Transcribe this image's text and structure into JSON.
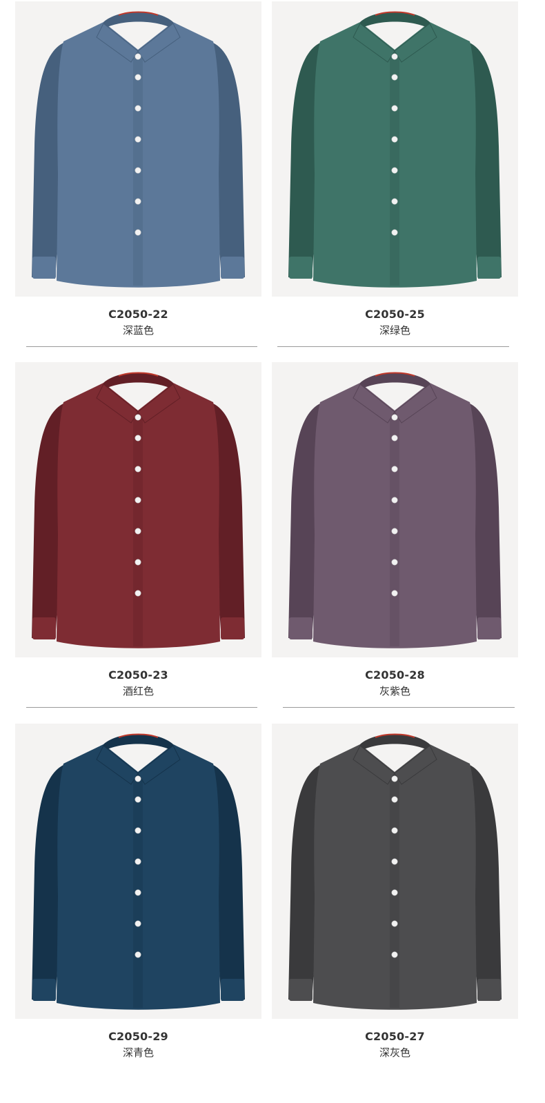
{
  "products": [
    {
      "code": "C2050-22",
      "color_name": "深蓝色",
      "shirt_color": "#5c7899",
      "shade_color": "#46607d"
    },
    {
      "code": "C2050-25",
      "color_name": "深绿色",
      "shirt_color": "#3f7468",
      "shade_color": "#2e5a50"
    },
    {
      "code": "C2050-23",
      "color_name": "酒红色",
      "shirt_color": "#7e2c33",
      "shade_color": "#621f26"
    },
    {
      "code": "C2050-28",
      "color_name": "灰紫色",
      "shirt_color": "#6f5a6e",
      "shade_color": "#574456"
    },
    {
      "code": "C2050-29",
      "color_name": "深青色",
      "shirt_color": "#1f4461",
      "shade_color": "#15334b"
    },
    {
      "code": "C2050-27",
      "color_name": "深灰色",
      "shirt_color": "#4d4d4f",
      "shade_color": "#3a3a3c"
    }
  ]
}
